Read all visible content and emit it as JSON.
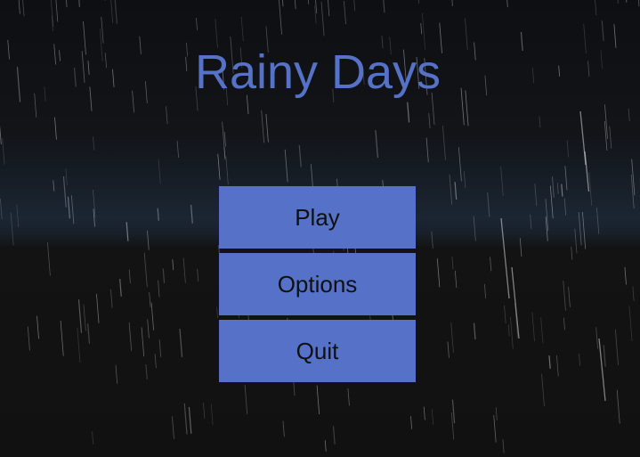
{
  "game": {
    "title": "Rainy Days"
  },
  "menu": {
    "play_label": "Play",
    "options_label": "Options",
    "quit_label": "Quit"
  },
  "colors": {
    "accent": "#5571c8",
    "title": "#5572c6",
    "button_text": "#101010",
    "background": "#121212"
  }
}
